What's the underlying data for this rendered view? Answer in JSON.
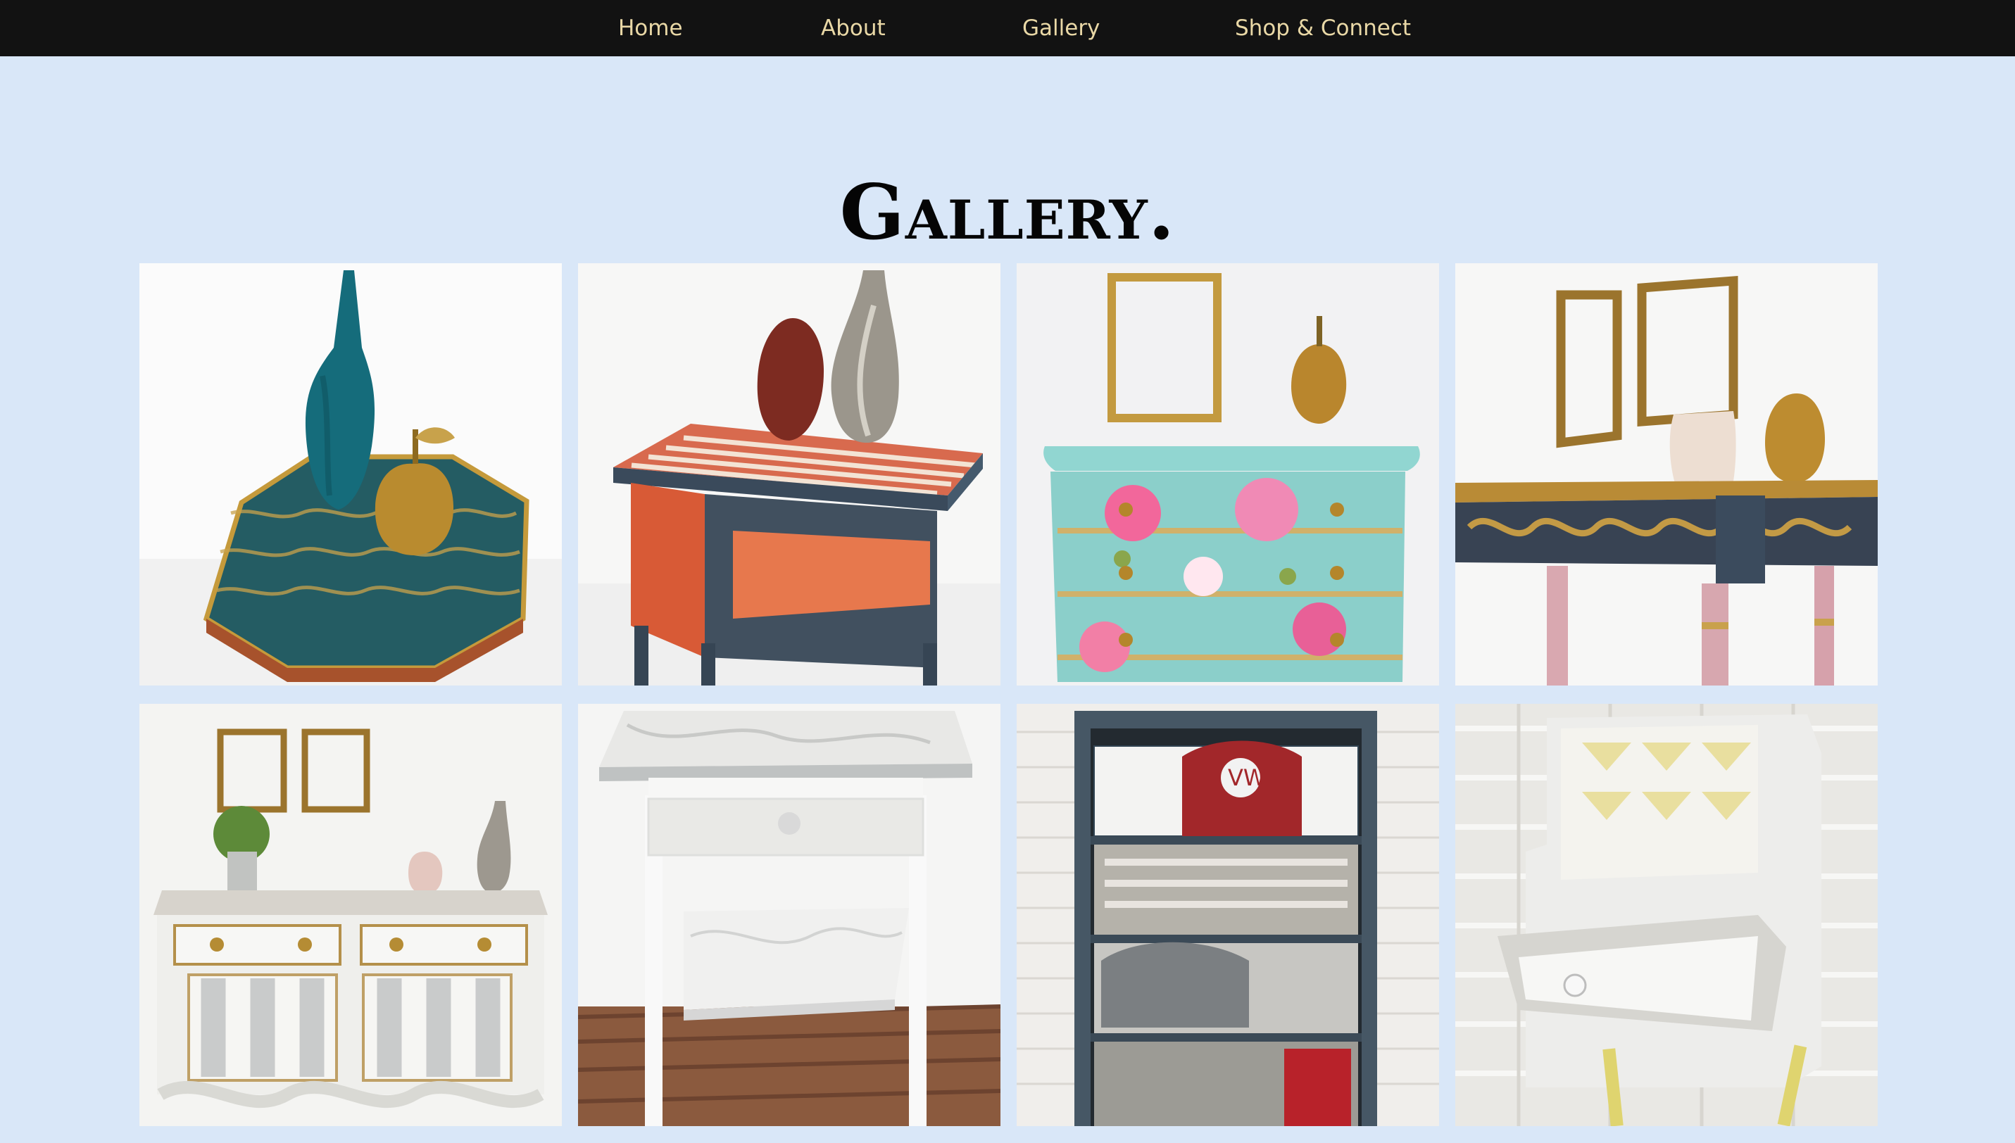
{
  "nav": {
    "items": [
      "Home",
      "About",
      "Gallery",
      "Shop & Connect"
    ]
  },
  "page": {
    "title": "Gallery."
  },
  "colors": {
    "nav_background": "#121212",
    "nav_text": "#e9d8a6",
    "page_background": "#d9e7f8",
    "title_text": "#050505"
  },
  "gallery": {
    "items": [
      {
        "name": "gallery-item-octagonal-teal-table"
      },
      {
        "name": "gallery-item-striped-orange-side-table"
      },
      {
        "name": "gallery-item-floral-aqua-drawers"
      },
      {
        "name": "gallery-item-console-table-trellis"
      },
      {
        "name": "gallery-item-white-sideboard"
      },
      {
        "name": "gallery-item-marble-top-nightstand"
      },
      {
        "name": "gallery-item-vw-bookcase"
      },
      {
        "name": "gallery-item-cream-shelf-nightstand"
      }
    ]
  }
}
